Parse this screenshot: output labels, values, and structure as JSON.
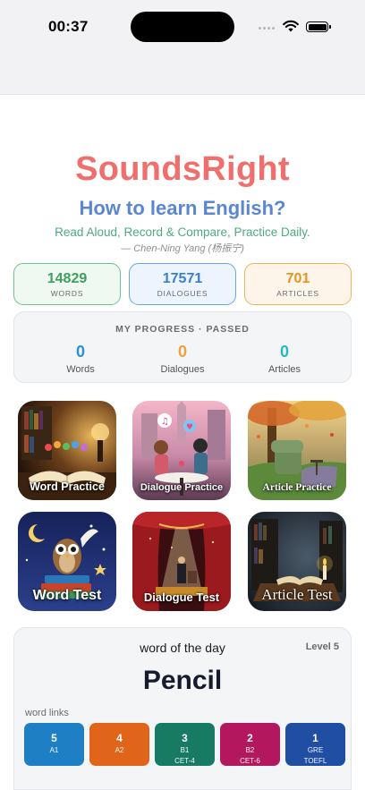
{
  "status_bar": {
    "time": "00:37",
    "icons": [
      "signal-dots-icon",
      "wifi-icon",
      "battery-icon"
    ]
  },
  "header": {
    "app_title": "SoundsRight",
    "subtitle": "How to learn English?",
    "quote": "Read Aloud, Record & Compare, Practice Daily.",
    "attribution": "— Chen-Ning Yang (杨振宁)"
  },
  "stats": [
    {
      "value": "14829",
      "label": "WORDS",
      "color": "#3e9f5f"
    },
    {
      "value": "17571",
      "label": "DIALOGUES",
      "color": "#3a7fce"
    },
    {
      "value": "701",
      "label": "ARTICLES",
      "color": "#e39424"
    }
  ],
  "progress": {
    "title": "MY PROGRESS · PASSED",
    "items": [
      {
        "value": "0",
        "label": "Words",
        "color": "#2b8fd6"
      },
      {
        "value": "0",
        "label": "Dialogues",
        "color": "#f0a23a"
      },
      {
        "value": "0",
        "label": "Articles",
        "color": "#28b8c4"
      }
    ]
  },
  "tiles": [
    {
      "label": "Word Practice",
      "image": "open-book-letters-illustration"
    },
    {
      "label": "Dialogue Practice",
      "image": "couple-cafe-dialogue-illustration"
    },
    {
      "label": "Article Practice",
      "image": "armchair-garden-reading-illustration"
    },
    {
      "label": "Word Test",
      "image": "owl-books-night-illustration"
    },
    {
      "label": "Dialogue Test",
      "image": "stage-speaker-spotlight-illustration"
    },
    {
      "label": "Article Test",
      "image": "library-desk-candle-illustration"
    }
  ],
  "word_of_the_day": {
    "title": "word of the day",
    "level": "Level 5",
    "word": "Pencil",
    "links_label": "word links",
    "links": [
      {
        "num": "5",
        "sub1": "A1",
        "sub2": "",
        "color": "#1f7fc4"
      },
      {
        "num": "4",
        "sub1": "A2",
        "sub2": "",
        "color": "#e0651a"
      },
      {
        "num": "3",
        "sub1": "B1",
        "sub2": "CET-4",
        "color": "#177a63"
      },
      {
        "num": "2",
        "sub1": "B2",
        "sub2": "CET-6",
        "color": "#b3175d"
      },
      {
        "num": "1",
        "sub1": "GRE",
        "sub2": "TOEFL",
        "color": "#1f4ea3"
      }
    ]
  }
}
